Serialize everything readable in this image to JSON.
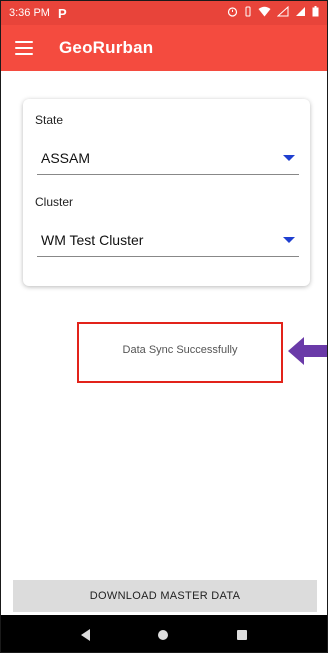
{
  "status_bar": {
    "time": "3:36 PM",
    "notification_letter": "P",
    "icons": [
      "alarm-icon",
      "vibrate-icon",
      "wifi-icon",
      "data-icon",
      "signal-icon",
      "battery-icon"
    ]
  },
  "app_bar": {
    "title": "GeoRurban"
  },
  "form": {
    "state_label": "State",
    "state_value": "ASSAM",
    "cluster_label": "Cluster",
    "cluster_value": "WM Test Cluster"
  },
  "message": {
    "text": "Data Sync Successfully"
  },
  "download_button": {
    "label": "DOWNLOAD MASTER DATA"
  },
  "colors": {
    "status_bar": "#e8443a",
    "app_bar": "#f44b3f",
    "dropdown_caret": "#1f3fd0",
    "highlight_box": "#e2231a",
    "arrow": "#6a3aa8"
  }
}
